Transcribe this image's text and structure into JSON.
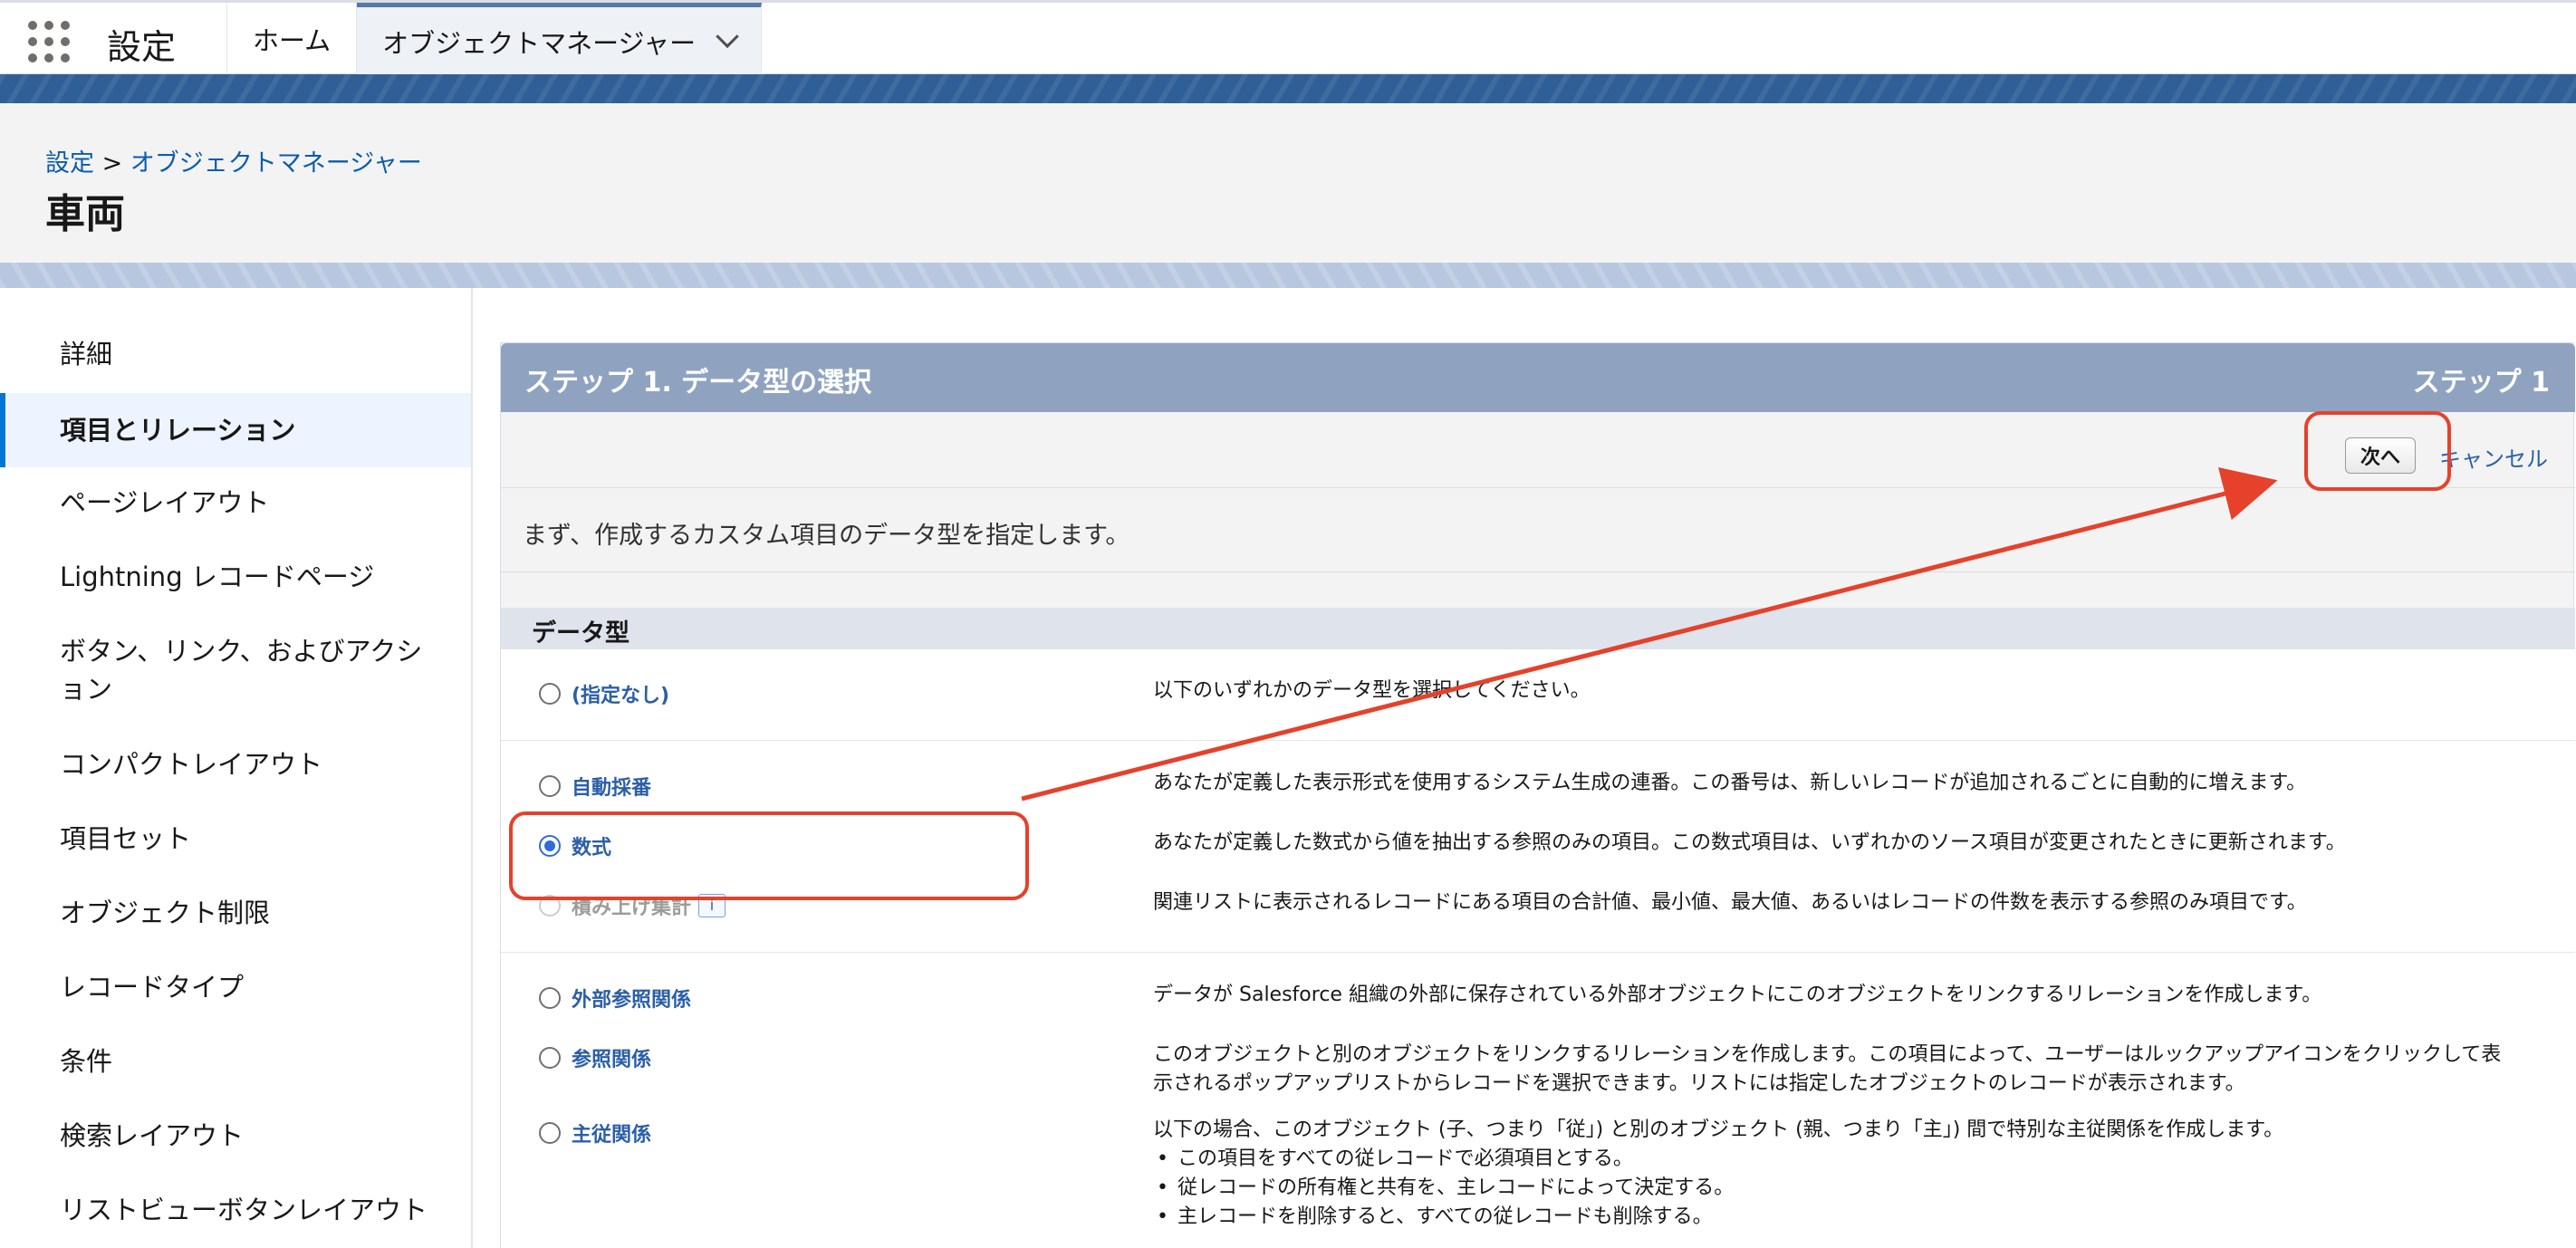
{
  "topbar": {
    "app_name": "設定",
    "tabs": [
      {
        "label": "ホーム"
      },
      {
        "label": "オブジェクトマネージャー"
      }
    ]
  },
  "breadcrumb": {
    "root": "設定",
    "sep": ">",
    "current": "オブジェクトマネージャー"
  },
  "page_title": "車両",
  "sidebar": {
    "items": [
      {
        "label": "詳細"
      },
      {
        "label": "項目とリレーション"
      },
      {
        "label": "ページレイアウト"
      },
      {
        "label": "Lightning レコードページ"
      },
      {
        "label": "ボタン、リンク、およびアクシ"
      },
      {
        "label": "ョン"
      },
      {
        "label": "コンパクトレイアウト"
      },
      {
        "label": "項目セット"
      },
      {
        "label": "オブジェクト制限"
      },
      {
        "label": "レコードタイプ"
      },
      {
        "label": "条件"
      },
      {
        "label": "検索レイアウト"
      },
      {
        "label": "リストビューボタンレイアウト"
      }
    ]
  },
  "step": {
    "title": "ステップ 1. データ型の選択",
    "right": "ステップ 1",
    "next_label": "次へ",
    "cancel_label": "キャンセル",
    "intro": "まず、作成するカスタム項目のデータ型を指定します。"
  },
  "datatype": {
    "heading": "データ型",
    "options": [
      {
        "label": "(指定なし)",
        "desc": "以下のいずれかのデータ型を選択してください。"
      },
      {
        "label": "自動採番",
        "desc": "あなたが定義した表示形式を使用するシステム生成の連番。この番号は、新しいレコードが追加されるごとに自動的に増えます。"
      },
      {
        "label": "数式",
        "desc": "あなたが定義した数式から値を抽出する参照のみの項目。この数式項目は、いずれかのソース項目が変更されたときに更新されます。"
      },
      {
        "label": "積み上げ集計",
        "badge": "i",
        "desc": "関連リストに表示されるレコードにある項目の合計値、最小値、最大値、あるいはレコードの件数を表示する参照のみ項目です。"
      },
      {
        "label": "外部参照関係",
        "desc": "データが Salesforce 組織の外部に保存されている外部オブジェクトにこのオブジェクトをリンクするリレーションを作成します。"
      },
      {
        "label": "参照関係",
        "desc1": "このオブジェクトと別のオブジェクトをリンクするリレーションを作成します。この項目によって、ユーザーはルックアップアイコンをクリックして表",
        "desc2": "示されるポップアップリストからレコードを選択できます。リストには指定したオブジェクトのレコードが表示されます。"
      },
      {
        "label": "主従関係",
        "desc": "以下の場合、このオブジェクト (子、つまり「従」) と別のオブジェクト (親、つまり「主」) 間で特別な主従関係を作成します。",
        "bullets": [
          "この項目をすべての従レコードで必須項目とする。",
          "従レコードの所有権と共有を、主レコードによって決定する。",
          "主レコードを削除すると、すべての従レコードも削除する。"
        ]
      }
    ]
  },
  "colors": {
    "accent": "#0176d3",
    "link": "#2b5fa6",
    "step_header": "#8fa3c1",
    "annotation": "#e5412b"
  }
}
